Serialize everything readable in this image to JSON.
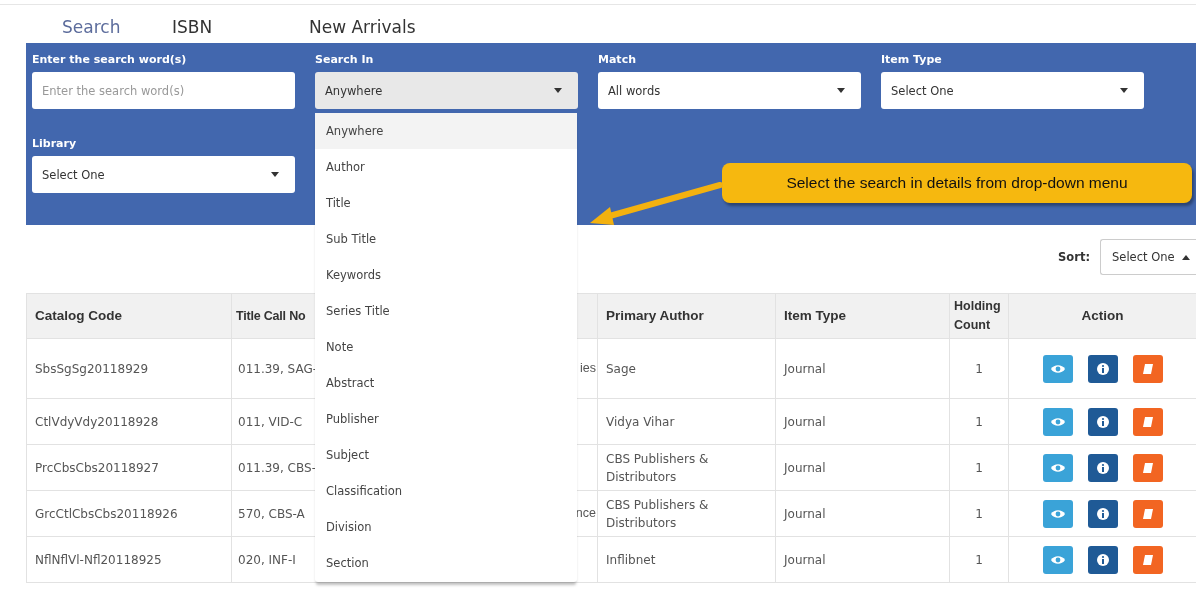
{
  "tabs": [
    {
      "label": "Search",
      "selected": true
    },
    {
      "label": "ISBN",
      "selected": false
    },
    {
      "label": "New Arrivals",
      "selected": false
    }
  ],
  "search_form": {
    "fields": [
      {
        "kind": "input",
        "label": "Enter the search word(s)",
        "placeholder": "Enter the search word(s)"
      },
      {
        "kind": "select",
        "label": "Search In",
        "value": "Anywhere",
        "open": true
      },
      {
        "kind": "select",
        "label": "Match",
        "value": "All words",
        "open": false
      },
      {
        "kind": "select",
        "label": "Item Type",
        "value": "Select One",
        "open": false
      },
      {
        "kind": "select",
        "label": "Library",
        "value": "Select One",
        "open": false
      }
    ],
    "search_in_options": [
      {
        "label": "Anywhere",
        "selected": true
      },
      {
        "label": "Author",
        "selected": false
      },
      {
        "label": "Title",
        "selected": false
      },
      {
        "label": "Sub Title",
        "selected": false
      },
      {
        "label": "Keywords",
        "selected": false
      },
      {
        "label": "Series Title",
        "selected": false
      },
      {
        "label": "Note",
        "selected": false
      },
      {
        "label": "Abstract",
        "selected": false
      },
      {
        "label": "Publisher",
        "selected": false
      },
      {
        "label": "Subject",
        "selected": false
      },
      {
        "label": "Classification",
        "selected": false
      },
      {
        "label": "Division",
        "selected": false
      },
      {
        "label": "Section",
        "selected": false
      }
    ]
  },
  "callout": {
    "text": "Select the search in details from drop-down menu"
  },
  "sort": {
    "label": "Sort:",
    "value": "Select One"
  },
  "table": {
    "columns": [
      "Catalog Code",
      "Title Call No",
      "",
      "Primary Author",
      "Item Type",
      "Holding Count",
      "Action"
    ],
    "rows": [
      {
        "catalog_code": "SbsSgSg20118929",
        "title_call_no": "011.39, SAG-",
        "column_3": "ies",
        "primary_author": "Sage",
        "item_type": "Journal",
        "holding_count": "1"
      },
      {
        "catalog_code": "CtlVdyVdy20118928",
        "title_call_no": "011, VID-C",
        "column_3": "",
        "primary_author": "Vidya Vihar",
        "item_type": "Journal",
        "holding_count": "1"
      },
      {
        "catalog_code": "PrcCbsCbs20118927",
        "title_call_no": "011.39, CBS-",
        "column_3": "",
        "primary_author": "CBS Publishers & Distributors",
        "item_type": "Journal",
        "holding_count": "1"
      },
      {
        "catalog_code": "GrcCtlCbsCbs20118926",
        "title_call_no": "570, CBS-A",
        "column_3": "nce",
        "primary_author": "CBS Publishers & Distributors",
        "item_type": "Journal",
        "holding_count": "1"
      },
      {
        "catalog_code": "NflNflVl-Nfl20118925",
        "title_call_no": "020, INF-I",
        "column_3": "",
        "primary_author": "Inflibnet",
        "item_type": "Journal",
        "holding_count": "1"
      }
    ]
  }
}
